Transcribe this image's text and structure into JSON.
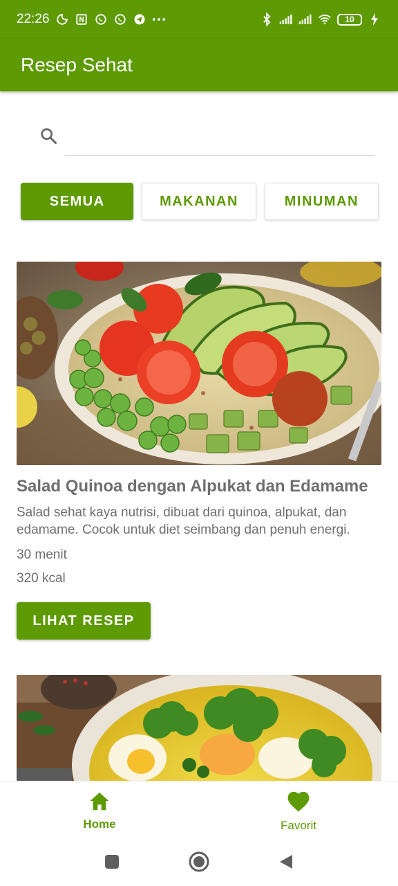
{
  "status_bar": {
    "time": "22:26",
    "battery": "10"
  },
  "app_bar": {
    "title": "Resep Sehat"
  },
  "search": {
    "placeholder": "",
    "value": ""
  },
  "filters": [
    {
      "label": "SEMUA",
      "active": true
    },
    {
      "label": "MAKANAN",
      "active": false
    },
    {
      "label": "MINUMAN",
      "active": false
    }
  ],
  "recipes": [
    {
      "title": "Salad Quinoa dengan Alpukat dan Edamame",
      "description": "Salad sehat kaya nutrisi, dibuat dari quinoa, alpukat, dan edamame. Cocok untuk diet seimbang dan penuh energi.",
      "duration": "30 menit",
      "calories": "320 kcal",
      "button": "LIHAT RESEP"
    }
  ],
  "bottom_nav": [
    {
      "label": "Home",
      "icon": "home-icon",
      "active": true
    },
    {
      "label": "Favorit",
      "icon": "heart-icon",
      "active": false
    }
  ],
  "colors": {
    "primary": "#5d9a04",
    "text_muted": "#6f6f6f"
  }
}
